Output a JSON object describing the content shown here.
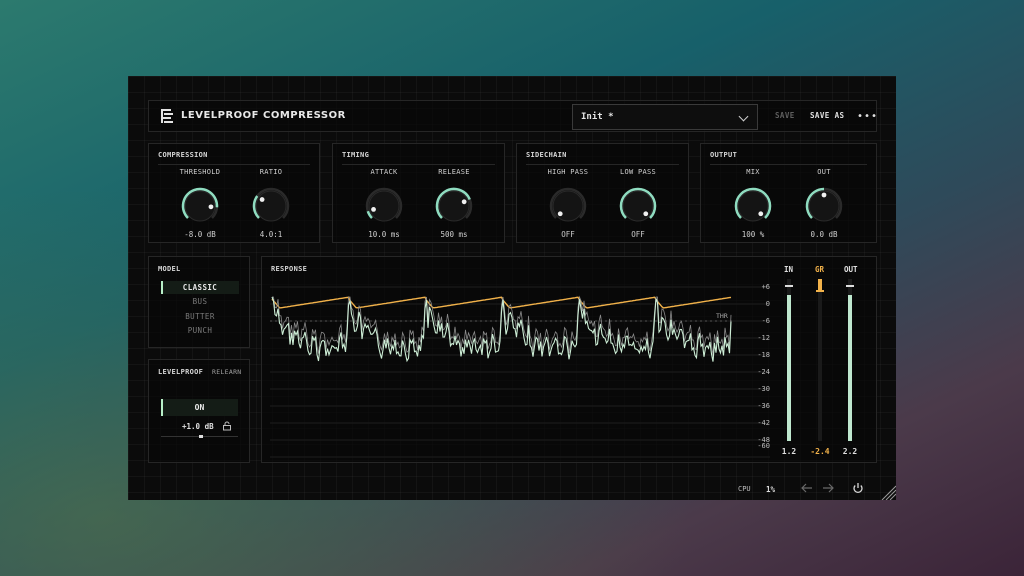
{
  "header": {
    "title": "LEVELPROOF COMPRESSOR",
    "preset": "Init *",
    "save_label": "SAVE",
    "save_as_label": "SAVE AS",
    "more_label": "•••"
  },
  "sections": {
    "compression": {
      "label": "COMPRESSION",
      "knobs": [
        {
          "label": "THRESHOLD",
          "value": "-8.0 dB",
          "level": 0.85
        },
        {
          "label": "RATIO",
          "value": "4.0:1",
          "level": 0.3
        }
      ]
    },
    "timing": {
      "label": "TIMING",
      "knobs": [
        {
          "label": "ATTACK",
          "value": "10.0 ms",
          "level": 0.1
        },
        {
          "label": "RELEASE",
          "value": "500 ms",
          "level": 0.75
        }
      ]
    },
    "sidechain": {
      "label": "SIDECHAIN",
      "knobs": [
        {
          "label": "HIGH PASS",
          "value": "OFF",
          "level": 0.0
        },
        {
          "label": "LOW PASS",
          "value": "OFF",
          "level": 1.0
        }
      ]
    },
    "output": {
      "label": "OUTPUT",
      "knobs": [
        {
          "label": "MIX",
          "value": "100 %",
          "level": 1.0
        },
        {
          "label": "OUT",
          "value": "0.0 dB",
          "level": 0.5
        }
      ]
    }
  },
  "model": {
    "label": "MODEL",
    "items": [
      "CLASSIC",
      "BUS",
      "BUTTER",
      "PUNCH"
    ],
    "selected": "CLASSIC"
  },
  "levelproof": {
    "label": "LEVELPROOF",
    "relearn_label": "RELEARN",
    "state": "ON",
    "gain": "+1.0 dB"
  },
  "response": {
    "label": "RESPONSE",
    "threshold_label": "THR",
    "scale": [
      "+6",
      "0",
      "-6",
      "-12",
      "-18",
      "-24",
      "-30",
      "-36",
      "-42",
      "-48",
      "-60"
    ]
  },
  "meters": [
    {
      "label": "IN",
      "value": "1.2",
      "level": 0.9,
      "color": "#bfe8cf"
    },
    {
      "label": "GR",
      "value": "-2.4",
      "level": 0.07,
      "color": "#f2b24a"
    },
    {
      "label": "OUT",
      "value": "2.2",
      "level": 0.9,
      "color": "#bfe8cf"
    }
  ],
  "footer": {
    "cpu_label": "CPU",
    "cpu_value": "1%"
  },
  "colors": {
    "accent": "#bfe8cf",
    "gain_reduction": "#f2b24a",
    "knob_arc": "#8fdcc0"
  }
}
